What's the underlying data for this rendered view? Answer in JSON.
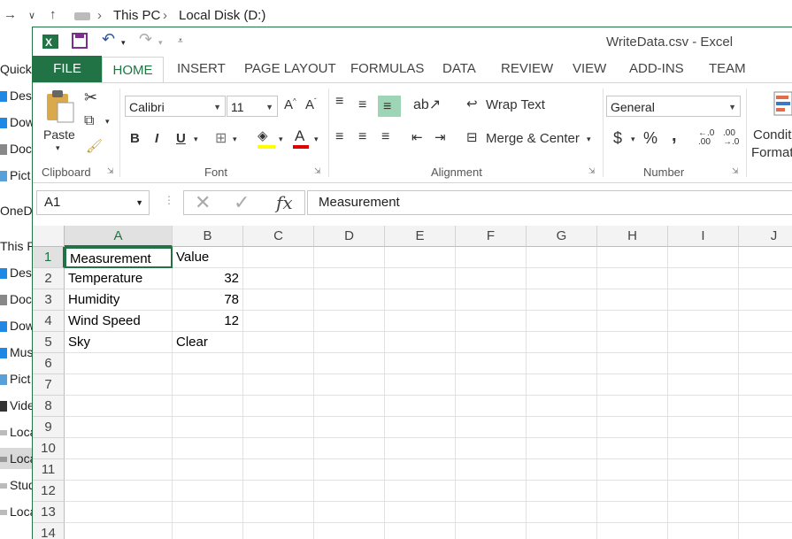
{
  "explorer": {
    "path": [
      "This PC",
      "Local Disk (D:)"
    ],
    "sidebar": [
      "Quick",
      "Des",
      "Dow",
      "Doc",
      "Pict",
      "OneD",
      "This P",
      "Des",
      "Doc",
      "Dow",
      "Mus",
      "Pict",
      "Vide",
      "Loca",
      "Loca",
      "Stud",
      "Loca"
    ]
  },
  "window": {
    "title": "WriteData.csv - Excel"
  },
  "ribbon_tabs": [
    "FILE",
    "HOME",
    "INSERT",
    "PAGE LAYOUT",
    "FORMULAS",
    "DATA",
    "REVIEW",
    "VIEW",
    "ADD-INS",
    "TEAM"
  ],
  "ribbon": {
    "clipboard": {
      "label": "Clipboard",
      "paste": "Paste"
    },
    "font": {
      "label": "Font",
      "name": "Calibri",
      "size": "11",
      "bold": "B",
      "italic": "I",
      "underline": "U"
    },
    "alignment": {
      "label": "Alignment",
      "wrap": "Wrap Text",
      "merge": "Merge & Center"
    },
    "number": {
      "label": "Number",
      "format": "General",
      "currency": "$",
      "percent": "%",
      "comma": ","
    },
    "styles": {
      "conditional_1": "Condit",
      "conditional_2": "Format"
    }
  },
  "formula_bar": {
    "name_box": "A1",
    "fx": "fx",
    "content": "Measurement"
  },
  "columns": [
    "A",
    "B",
    "C",
    "D",
    "E",
    "F",
    "G",
    "H",
    "I",
    "J"
  ],
  "rows": [
    "1",
    "2",
    "3",
    "4",
    "5",
    "6",
    "7",
    "8",
    "9",
    "10",
    "11",
    "12",
    "13",
    "14"
  ],
  "cells": [
    [
      "Measurement",
      "Value"
    ],
    [
      "Temperature",
      "32"
    ],
    [
      "Humidity",
      "78"
    ],
    [
      "Wind Speed",
      "12"
    ],
    [
      "Sky",
      "Clear"
    ]
  ],
  "colors": {
    "excel_green": "#217346",
    "header_bg": "#f3f3f3"
  }
}
